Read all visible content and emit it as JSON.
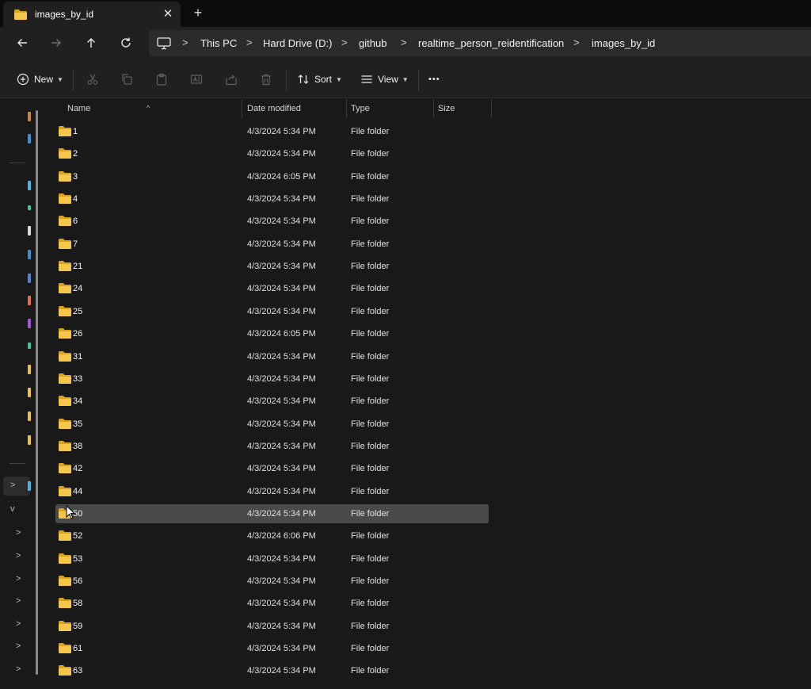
{
  "tab": {
    "title": "images_by_id",
    "close": "✕",
    "new": "+"
  },
  "address": {
    "crumbs": [
      "This PC",
      "Hard Drive (D:)",
      "github",
      "realtime_person_reidentification",
      "images_by_id"
    ],
    "separator": ">"
  },
  "commands": {
    "new": "New",
    "sort": "Sort",
    "view": "View",
    "more": "•••"
  },
  "columns": {
    "name": "Name",
    "date": "Date modified",
    "type": "Type",
    "size": "Size"
  },
  "files": [
    {
      "name": "1",
      "date": "4/3/2024 5:34 PM",
      "type": "File folder"
    },
    {
      "name": "2",
      "date": "4/3/2024 5:34 PM",
      "type": "File folder"
    },
    {
      "name": "3",
      "date": "4/3/2024 6:05 PM",
      "type": "File folder"
    },
    {
      "name": "4",
      "date": "4/3/2024 5:34 PM",
      "type": "File folder"
    },
    {
      "name": "6",
      "date": "4/3/2024 5:34 PM",
      "type": "File folder"
    },
    {
      "name": "7",
      "date": "4/3/2024 5:34 PM",
      "type": "File folder"
    },
    {
      "name": "21",
      "date": "4/3/2024 5:34 PM",
      "type": "File folder"
    },
    {
      "name": "24",
      "date": "4/3/2024 5:34 PM",
      "type": "File folder"
    },
    {
      "name": "25",
      "date": "4/3/2024 5:34 PM",
      "type": "File folder"
    },
    {
      "name": "26",
      "date": "4/3/2024 6:05 PM",
      "type": "File folder"
    },
    {
      "name": "31",
      "date": "4/3/2024 5:34 PM",
      "type": "File folder"
    },
    {
      "name": "33",
      "date": "4/3/2024 5:34 PM",
      "type": "File folder"
    },
    {
      "name": "34",
      "date": "4/3/2024 5:34 PM",
      "type": "File folder"
    },
    {
      "name": "35",
      "date": "4/3/2024 5:34 PM",
      "type": "File folder"
    },
    {
      "name": "38",
      "date": "4/3/2024 5:34 PM",
      "type": "File folder"
    },
    {
      "name": "42",
      "date": "4/3/2024 5:34 PM",
      "type": "File folder"
    },
    {
      "name": "44",
      "date": "4/3/2024 5:34 PM",
      "type": "File folder"
    },
    {
      "name": "50",
      "date": "4/3/2024 5:34 PM",
      "type": "File folder",
      "selected": true
    },
    {
      "name": "52",
      "date": "4/3/2024 6:06 PM",
      "type": "File folder"
    },
    {
      "name": "53",
      "date": "4/3/2024 5:34 PM",
      "type": "File folder"
    },
    {
      "name": "56",
      "date": "4/3/2024 5:34 PM",
      "type": "File folder"
    },
    {
      "name": "58",
      "date": "4/3/2024 5:34 PM",
      "type": "File folder"
    },
    {
      "name": "59",
      "date": "4/3/2024 5:34 PM",
      "type": "File folder"
    },
    {
      "name": "61",
      "date": "4/3/2024 5:34 PM",
      "type": "File folder"
    },
    {
      "name": "63",
      "date": "4/3/2024 5:34 PM",
      "type": "File folder"
    }
  ],
  "colors": {
    "folder": "#f4c74b",
    "folder_dark": "#d9a520",
    "selection": "#4a4a4a",
    "background": "#191919"
  },
  "icons": {
    "back": "back-arrow-icon",
    "forward": "forward-arrow-icon",
    "up": "up-arrow-icon",
    "refresh": "refresh-icon",
    "pc": "computer-icon",
    "folder": "folder-icon"
  }
}
